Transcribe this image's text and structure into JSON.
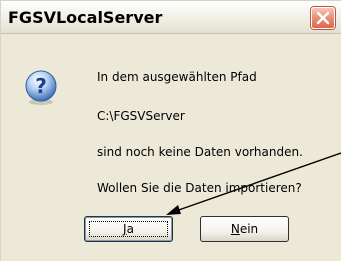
{
  "dialog": {
    "title": "FGSVLocalServer",
    "message_lines": [
      "In dem ausgewählten Pfad",
      "C:\\FGSVServer",
      " sind noch keine Daten vorhanden.",
      "Wollen Sie die Daten importieren?"
    ],
    "icon": "question-icon",
    "buttons": {
      "yes": {
        "label_mnemonic": "J",
        "label_rest": "a"
      },
      "no": {
        "label_mnemonic": "N",
        "label_rest": "ein"
      }
    }
  },
  "colors": {
    "dialog_background": "#ece9d8",
    "close_button": "#e07358",
    "annotation_arrow": "#000000"
  }
}
